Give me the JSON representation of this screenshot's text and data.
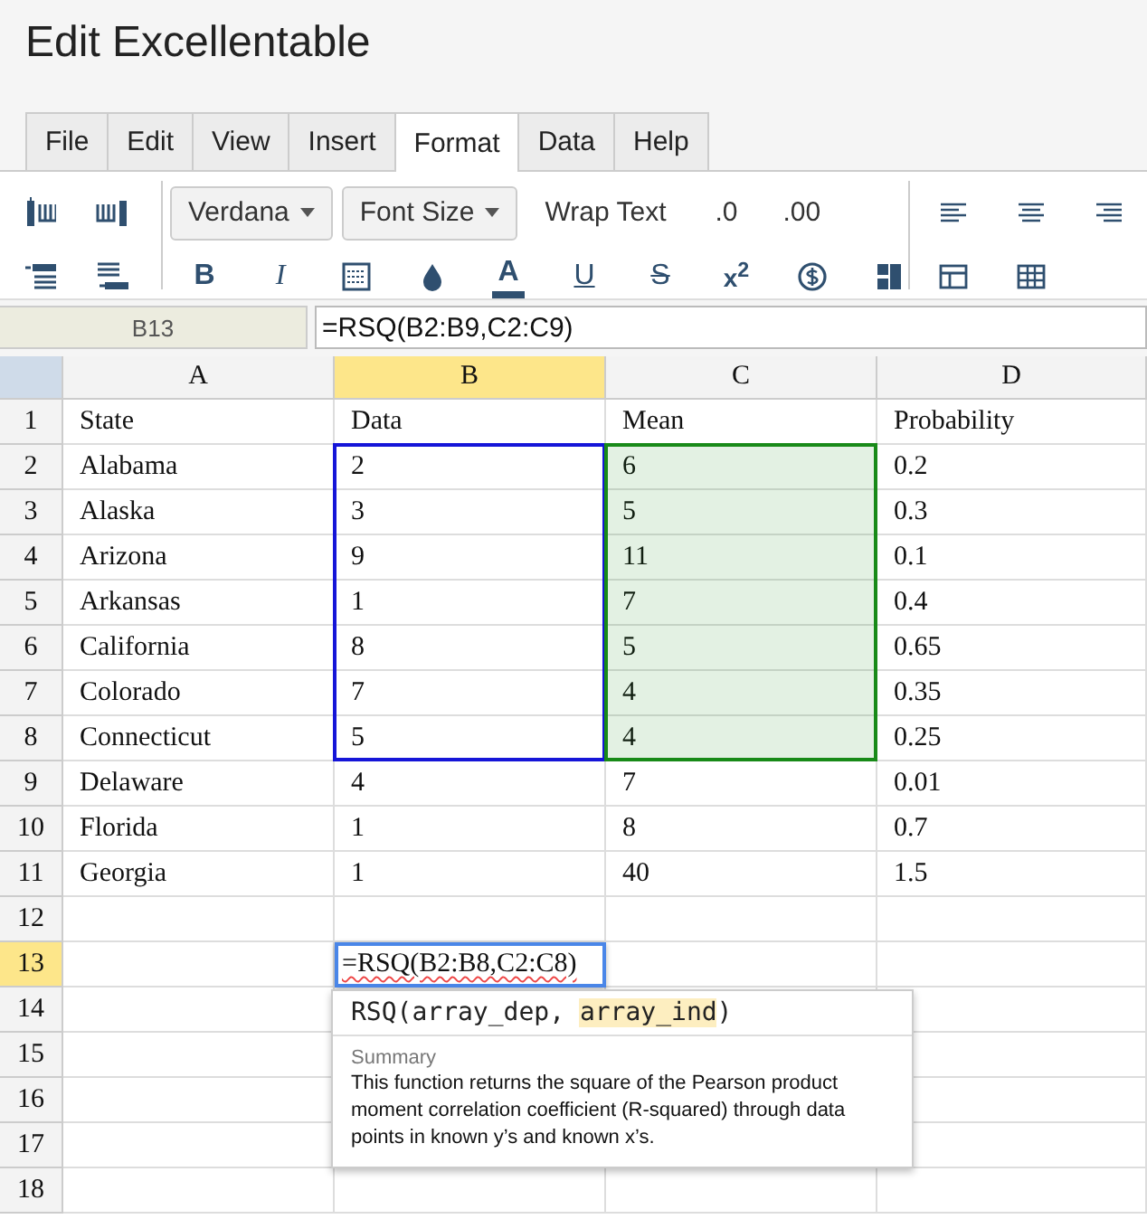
{
  "title": "Edit Excellentable",
  "menu_tabs": [
    {
      "label": "File",
      "selected": false
    },
    {
      "label": "Edit",
      "selected": false
    },
    {
      "label": "View",
      "selected": false
    },
    {
      "label": "Insert",
      "selected": false
    },
    {
      "label": "Format",
      "selected": true
    },
    {
      "label": "Data",
      "selected": false
    },
    {
      "label": "Help",
      "selected": false
    }
  ],
  "toolbar": {
    "dropdowns": [
      "Verdana",
      "Font Size"
    ],
    "text_buttons": [
      "Wrap Text",
      ".0",
      ".00"
    ],
    "style_buttons": [
      "B",
      "I",
      "A",
      "U",
      "S",
      "x$^{2}$"
    ]
  },
  "name_box": "B13",
  "formula": "=RSQ(B2:B9,C2:C9)",
  "columns": [
    {
      "label": "A",
      "selected": false
    },
    {
      "label": "B",
      "selected": true
    },
    {
      "label": "C",
      "selected": false
    },
    {
      "label": "D",
      "selected": false
    }
  ],
  "ranges": [
    {
      "kind": "dependent",
      "color": "#1515d8",
      "filled": false
    },
    {
      "kind": "independent",
      "color": "#188a18",
      "filled": true
    }
  ],
  "rows": [
    {
      "number": "1",
      "selected": false,
      "cells": [
        {
          "text": "State"
        },
        {
          "text": "Data"
        },
        {
          "text": "Mean"
        },
        {
          "text": "Probability"
        }
      ]
    },
    {
      "number": "2",
      "selected": false,
      "cells": [
        {
          "text": "Alabama"
        },
        {
          "text": "2",
          "kind": "dependent"
        },
        {
          "text": "6",
          "kind": "independent"
        },
        {
          "text": "0.2"
        }
      ]
    },
    {
      "number": "3",
      "selected": false,
      "cells": [
        {
          "text": "Alaska"
        },
        {
          "text": "3",
          "kind": "dependent"
        },
        {
          "text": "5",
          "kind": "independent"
        },
        {
          "text": "0.3"
        }
      ]
    },
    {
      "number": "4",
      "selected": false,
      "cells": [
        {
          "text": "Arizona"
        },
        {
          "text": "9",
          "kind": "dependent"
        },
        {
          "text": "11",
          "kind": "independent"
        },
        {
          "text": "0.1"
        }
      ]
    },
    {
      "number": "5",
      "selected": false,
      "cells": [
        {
          "text": "Arkansas"
        },
        {
          "text": "1",
          "kind": "dependent"
        },
        {
          "text": "7",
          "kind": "independent"
        },
        {
          "text": "0.4"
        }
      ]
    },
    {
      "number": "6",
      "selected": false,
      "cells": [
        {
          "text": "California"
        },
        {
          "text": "8",
          "kind": "dependent"
        },
        {
          "text": "5",
          "kind": "independent"
        },
        {
          "text": "0.65"
        }
      ]
    },
    {
      "number": "7",
      "selected": false,
      "cells": [
        {
          "text": "Colorado"
        },
        {
          "text": "7",
          "kind": "dependent"
        },
        {
          "text": "4",
          "kind": "independent"
        },
        {
          "text": "0.35"
        }
      ]
    },
    {
      "number": "8",
      "selected": false,
      "cells": [
        {
          "text": "Connecticut"
        },
        {
          "text": "5",
          "kind": "dependent"
        },
        {
          "text": "4",
          "kind": "independent"
        },
        {
          "text": "0.25"
        }
      ]
    },
    {
      "number": "9",
      "selected": false,
      "cells": [
        {
          "text": "Delaware"
        },
        {
          "text": "4"
        },
        {
          "text": "7"
        },
        {
          "text": "0.01"
        }
      ]
    },
    {
      "number": "10",
      "selected": false,
      "cells": [
        {
          "text": "Florida"
        },
        {
          "text": "1"
        },
        {
          "text": "8"
        },
        {
          "text": "0.7"
        }
      ]
    },
    {
      "number": "11",
      "selected": false,
      "cells": [
        {
          "text": "Georgia"
        },
        {
          "text": "1"
        },
        {
          "text": "40"
        },
        {
          "text": "1.5"
        }
      ]
    },
    {
      "number": "12",
      "selected": false,
      "cells": []
    },
    {
      "number": "13",
      "selected": true,
      "cells": [
        {
          "kind": "empty"
        },
        {
          "kind": "editor",
          "text": "=RSQ(B2:B8,C2:C8)"
        }
      ]
    },
    {
      "number": "14",
      "selected": false,
      "cells": []
    },
    {
      "number": "15",
      "selected": false,
      "cells": []
    },
    {
      "number": "16",
      "selected": false,
      "cells": []
    },
    {
      "number": "17",
      "selected": false,
      "cells": []
    },
    {
      "number": "18",
      "selected": false,
      "cells": []
    }
  ],
  "tooltip": {
    "signature": [
      {
        "text": "RSQ(array_dep, ",
        "selected": false
      },
      {
        "text": "array_ind",
        "selected": true
      },
      {
        "text": ")",
        "selected": false
      }
    ],
    "summary_label": "Summary",
    "description": "This function returns the square of the Pearson product moment correlation coefficient (R-squared) through data points in known y’s and known x’s."
  }
}
